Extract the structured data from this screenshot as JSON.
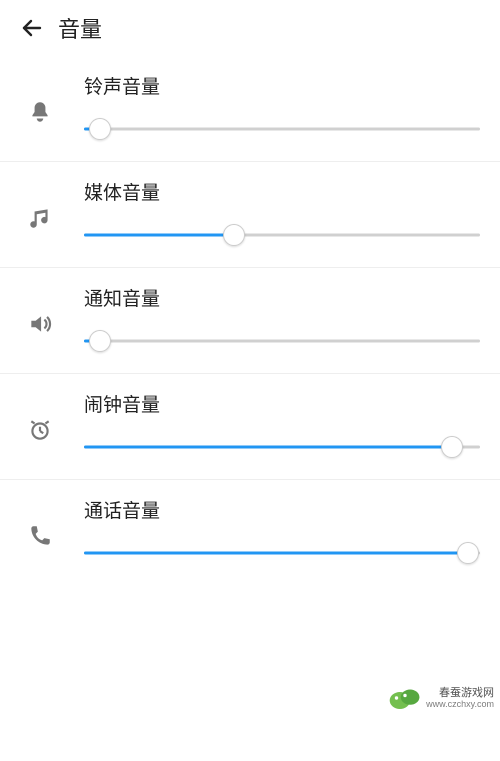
{
  "header": {
    "title": "音量"
  },
  "rows": [
    {
      "id": "ringtone",
      "label": "铃声音量",
      "value": 4
    },
    {
      "id": "media",
      "label": "媒体音量",
      "value": 38
    },
    {
      "id": "notify",
      "label": "通知音量",
      "value": 4
    },
    {
      "id": "alarm",
      "label": "闹钟音量",
      "value": 93
    },
    {
      "id": "call",
      "label": "通话音量",
      "value": 97
    }
  ],
  "watermark": {
    "line1": "春蚕游戏网",
    "line2": "www.czchxy.com"
  },
  "colors": {
    "accent": "#2196f3",
    "track": "#d0d0d0"
  }
}
